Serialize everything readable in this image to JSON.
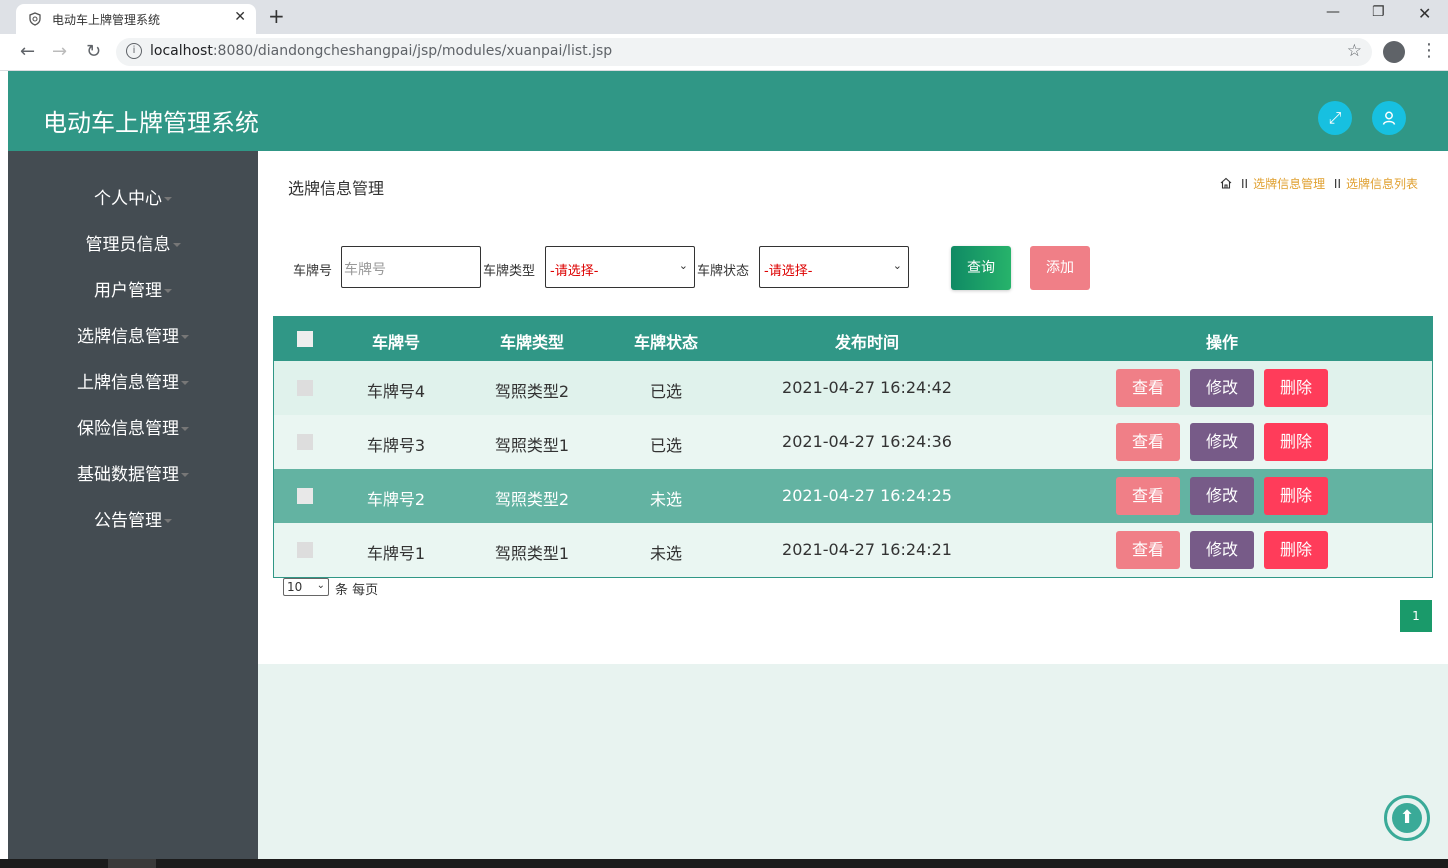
{
  "browser": {
    "tab_title": "电动车上牌管理系统",
    "url_host": "localhost",
    "url_rest": ":8080/diandongcheshangpai/jsp/modules/xuanpai/list.jsp"
  },
  "app": {
    "title": "电动车上牌管理系统"
  },
  "sidebar": {
    "items": [
      {
        "label": "个人中心"
      },
      {
        "label": "管理员信息"
      },
      {
        "label": "用户管理"
      },
      {
        "label": "选牌信息管理"
      },
      {
        "label": "上牌信息管理"
      },
      {
        "label": "保险信息管理"
      },
      {
        "label": "基础数据管理"
      },
      {
        "label": "公告管理"
      }
    ]
  },
  "page": {
    "title": "选牌信息管理",
    "breadcrumb": [
      "选牌信息管理",
      "选牌信息列表"
    ],
    "breadcrumb_sep": "II"
  },
  "search": {
    "plate_label": "车牌号",
    "plate_placeholder": "车牌号",
    "type_label": "车牌类型",
    "type_value": "-请选择-",
    "status_label": "车牌状态",
    "status_value": "-请选择-",
    "query_label": "查询",
    "add_label": "添加"
  },
  "table": {
    "headers": [
      "车牌号",
      "车牌类型",
      "车牌状态",
      "发布时间",
      "操作"
    ],
    "rows": [
      {
        "plate": "车牌号4",
        "type": "驾照类型2",
        "status": "已选",
        "time": "2021-04-27 16:24:42"
      },
      {
        "plate": "车牌号3",
        "type": "驾照类型1",
        "status": "已选",
        "time": "2021-04-27 16:24:36"
      },
      {
        "plate": "车牌号2",
        "type": "驾照类型2",
        "status": "未选",
        "time": "2021-04-27 16:24:25"
      },
      {
        "plate": "车牌号1",
        "type": "驾照类型1",
        "status": "未选",
        "time": "2021-04-27 16:24:21"
      }
    ],
    "actions": {
      "view": "查看",
      "edit": "修改",
      "delete": "删除"
    }
  },
  "pager": {
    "page_size": "10",
    "suffix": "条 每页",
    "current_page": "1"
  },
  "colors": {
    "header_bg": "#309786",
    "sidebar_bg": "#444c52",
    "view_btn": "#f07f87",
    "edit_btn": "#775b88",
    "delete_btn": "#ff3c5a"
  }
}
